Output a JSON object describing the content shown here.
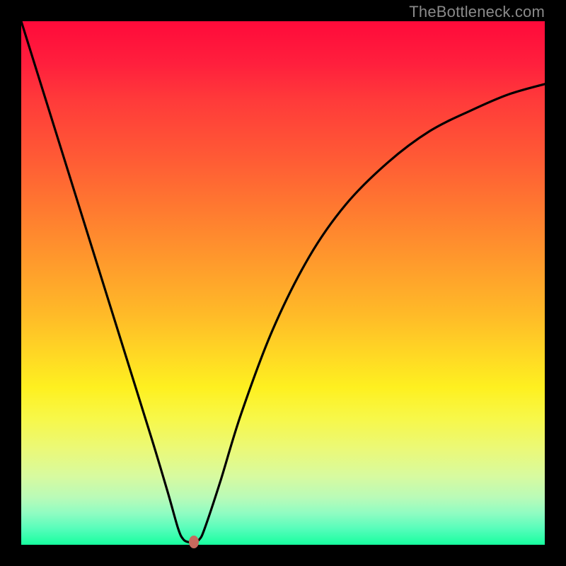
{
  "watermark": "TheBottleneck.com",
  "colors": {
    "curve": "#000000",
    "marker": "#c6695d",
    "background": "#000000"
  },
  "chart_data": {
    "type": "line",
    "title": "",
    "xlabel": "",
    "ylabel": "",
    "xlim": [
      0,
      100
    ],
    "ylim": [
      0,
      100
    ],
    "grid": false,
    "series": [
      {
        "name": "bottleneck-curve",
        "x": [
          0,
          5,
          10,
          15,
          20,
          25,
          28,
          30,
          31,
          32,
          33,
          34,
          35,
          38,
          42,
          48,
          55,
          62,
          70,
          78,
          86,
          93,
          100
        ],
        "values": [
          100,
          84,
          68,
          52,
          36,
          20,
          10,
          3,
          1,
          0.5,
          0.5,
          1,
          3,
          12,
          25,
          41,
          55,
          65,
          73,
          79,
          83,
          86,
          88
        ]
      }
    ],
    "marker": {
      "x": 33,
      "y": 0.5
    },
    "gradient_stops": [
      {
        "pos": 0,
        "color": "#ff0a3a"
      },
      {
        "pos": 15,
        "color": "#ff3a3a"
      },
      {
        "pos": 36,
        "color": "#ff7a30"
      },
      {
        "pos": 56,
        "color": "#ffba28"
      },
      {
        "pos": 70,
        "color": "#fef020"
      },
      {
        "pos": 87,
        "color": "#d7faa0"
      },
      {
        "pos": 100,
        "color": "#17fe9f"
      }
    ]
  }
}
